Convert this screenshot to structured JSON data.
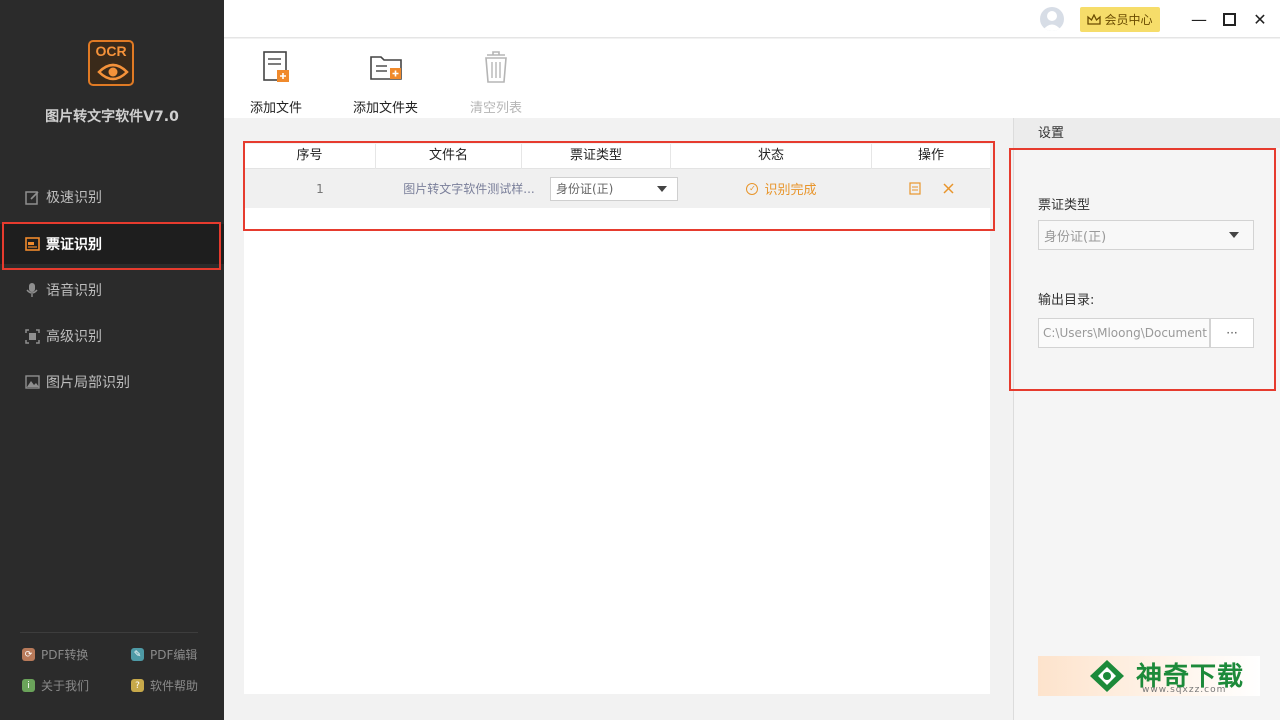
{
  "app": {
    "logo_text": "OCR",
    "name": "图片转文字软件V7.0"
  },
  "sidebar": {
    "items": [
      {
        "label": "极速识别",
        "icon": "fast-recognition-icon",
        "active": false
      },
      {
        "label": "票证识别",
        "icon": "ticket-recognition-icon",
        "active": true
      },
      {
        "label": "语音识别",
        "icon": "microphone-icon",
        "active": false
      },
      {
        "label": "高级识别",
        "icon": "advanced-recognition-icon",
        "active": false
      },
      {
        "label": "图片局部识别",
        "icon": "image-region-icon",
        "active": false
      }
    ],
    "footer_links": [
      {
        "label": "PDF转换",
        "icon": "pdf-convert-icon",
        "color": "#b87a5a"
      },
      {
        "label": "PDF编辑",
        "icon": "pdf-edit-icon",
        "color": "#4e9aa6"
      },
      {
        "label": "关于我们",
        "icon": "about-icon",
        "color": "#6aa35a"
      },
      {
        "label": "软件帮助",
        "icon": "help-icon",
        "color": "#c7a94a"
      }
    ]
  },
  "titlebar": {
    "vip_label": "会员中心",
    "minimize": "—",
    "maximize": "☐",
    "close": "✕"
  },
  "toolbar": {
    "add_file": "添加文件",
    "add_folder": "添加文件夹",
    "clear_list": "清空列表"
  },
  "table": {
    "headers": [
      "序号",
      "文件名",
      "票证类型",
      "状态",
      "操作"
    ],
    "rows": [
      {
        "index": "1",
        "filename": "图片转文字软件测试样...",
        "ticket_type": "身份证(正)",
        "status": "识别完成"
      }
    ]
  },
  "settings": {
    "title": "设置",
    "ticket_type_label": "票证类型",
    "ticket_type_value": "身份证(正)",
    "output_dir_label": "输出目录:",
    "output_dir_value": "C:\\Users\\Mloong\\Document",
    "browse_label": "···"
  },
  "watermark": {
    "text": "神奇下载",
    "url": "www.sqxzz.com"
  },
  "colors": {
    "accent_orange": "#f08a2c",
    "highlight_red": "#e63b2e",
    "status_orange": "#e8952b",
    "sidebar_bg": "#2b2b2b",
    "vip_yellow": "#f6dd6a"
  }
}
